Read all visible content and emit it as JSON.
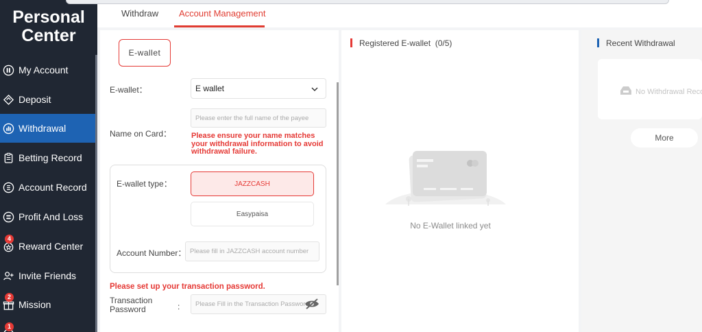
{
  "sidebar": {
    "title_line1": "Personal",
    "title_line2": "Center",
    "items": [
      {
        "label": "My Account",
        "icon": "my-account-icon"
      },
      {
        "label": "Deposit",
        "icon": "deposit-icon"
      },
      {
        "label": "Withdrawal",
        "icon": "withdrawal-icon",
        "active": true
      },
      {
        "label": "Betting Record",
        "icon": "betting-record-icon"
      },
      {
        "label": "Account Record",
        "icon": "account-record-icon"
      },
      {
        "label": "Profit And Loss",
        "icon": "profit-loss-icon"
      },
      {
        "label": "Reward Center",
        "icon": "reward-center-icon",
        "badge": "4"
      },
      {
        "label": "Invite Friends",
        "icon": "invite-friends-icon"
      },
      {
        "label": "Mission",
        "icon": "mission-icon",
        "badge": "2"
      },
      {
        "label": "",
        "icon": "message-icon",
        "badge": "1"
      }
    ]
  },
  "tabs": {
    "withdraw": "Withdraw",
    "account_management": "Account Management"
  },
  "form": {
    "ewallet_button": "E-wallet",
    "ewallet_label": "E-wallet：",
    "ewallet_selected": "E wallet",
    "name_label": "Name on Card：",
    "name_placeholder": "Please enter the full name of the payee",
    "name_warning": "Please ensure your name matches your withdrawal information to avoid withdrawal failure.",
    "type_label": "E-wallet type：",
    "type_options": [
      "JAZZCASH",
      "Easypaisa"
    ],
    "account_label": "Account Number：",
    "account_placeholder": "Please fill in JAZZCASH account number",
    "txn_warning": "Please set up your transaction password.",
    "txn_label_line1": "Transaction",
    "txn_label_line2": "Password",
    "txn_colon": ":",
    "txn_placeholder": "Please Fill in the Transaction Password"
  },
  "registered": {
    "title": "Registered E-wallet",
    "count": "(0/5)",
    "empty": "No E-Wallet linked yet"
  },
  "recent": {
    "title": "Recent Withdrawal",
    "empty": "No Withdrawal Records",
    "more": "More"
  },
  "colors": {
    "sidebar_bg": "#202733",
    "active_bg": "#1e63b3",
    "accent_red": "#e53935",
    "section_blue": "#1e63b3"
  }
}
